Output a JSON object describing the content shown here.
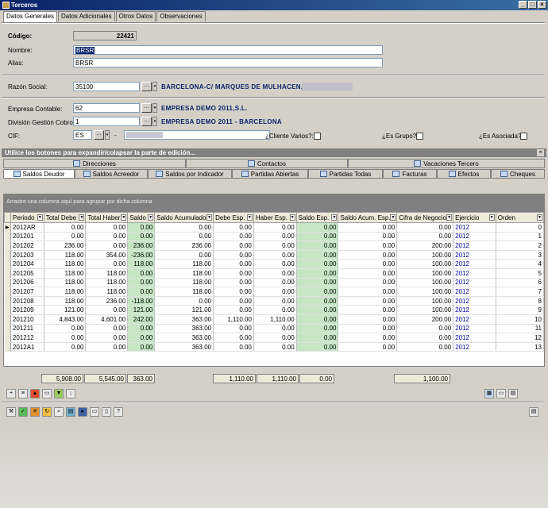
{
  "window": {
    "title": "Terceros",
    "min": "_",
    "max": "□",
    "close": "×"
  },
  "main_tabs": [
    "Datos Generales",
    "Datos Adicionales",
    "Otros Datos",
    "Observaciones"
  ],
  "form": {
    "codigo_label": "Código:",
    "codigo": "22421",
    "nombre_label": "Nombre:",
    "nombre": "BRSR",
    "alias_label": "Alias:",
    "alias": "BRSR",
    "razon_label": "Razón Social:",
    "razon_code": "35100",
    "razon_desc": "BARCELONA-C/ MARQUES DE MULHACEN,",
    "empresa_label": "Empresa Contable:",
    "empresa_code": "62",
    "empresa_desc": "EMPRESA DEMO 2011,S.L.",
    "division_label": "División Gestión Cobros:",
    "division_code": "1",
    "division_desc": "EMPRESA DEMO 2011 - BARCELONA",
    "cif_label": "CIF:",
    "cif_country": "ES",
    "cif_dash": "-",
    "cliente_varios": "¿Cliente Varios?:",
    "es_grupo": "¿Es Grupo?:",
    "es_asociada": "¿Es Asociada?:",
    "ellipsis": "...",
    "dropdown": "▾"
  },
  "group_header": "Utilice los botones para expandir/colapsar la parte de edición...",
  "sub_tabs_row1": [
    "Direcciones",
    "Contactos",
    "Vacaciones Tercero"
  ],
  "sub_tabs_row2": [
    "Saldos Deudor",
    "Saldos Acreedor",
    "Saldos por Indicador",
    "Partidas Abiertas",
    "Partidas Todas",
    "Facturas",
    "Efectos",
    "Cheques"
  ],
  "drag_hint": "Arrastre una columna aquí para agrupar por dicha columna",
  "columns": [
    "Periodo",
    "Total Debe",
    "Total Haber",
    "Saldo",
    "Saldo Acumulado",
    "Debe Esp.",
    "Haber Esp.",
    "Saldo Esp.",
    "Saldo Acum. Esp.",
    "Cifra de Negocio",
    "Ejercicio",
    "Orden"
  ],
  "rows": [
    [
      "2012AR",
      "0.00",
      "0.00",
      "0.00",
      "0.00",
      "0.00",
      "0.00",
      "0.00",
      "0.00",
      "0.00",
      "2012",
      "0"
    ],
    [
      "201201",
      "0.00",
      "0.00",
      "0.00",
      "0.00",
      "0.00",
      "0.00",
      "0.00",
      "0.00",
      "0.00",
      "2012",
      "1"
    ],
    [
      "201202",
      "236.00",
      "0.00",
      "236.00",
      "236.00",
      "0.00",
      "0.00",
      "0.00",
      "0.00",
      "200.00",
      "2012",
      "2"
    ],
    [
      "201203",
      "118.00",
      "354.00",
      "-236.00",
      "0.00",
      "0.00",
      "0.00",
      "0.00",
      "0.00",
      "100.00",
      "2012",
      "3"
    ],
    [
      "201204",
      "118.00",
      "0.00",
      "118.00",
      "118.00",
      "0.00",
      "0.00",
      "0.00",
      "0.00",
      "100.00",
      "2012",
      "4"
    ],
    [
      "201205",
      "118.00",
      "118.00",
      "0.00",
      "118.00",
      "0.00",
      "0.00",
      "0.00",
      "0.00",
      "100.00",
      "2012",
      "5"
    ],
    [
      "201206",
      "118.00",
      "118.00",
      "0.00",
      "118.00",
      "0.00",
      "0.00",
      "0.00",
      "0.00",
      "100.00",
      "2012",
      "6"
    ],
    [
      "201207",
      "118.00",
      "118.00",
      "0.00",
      "118.00",
      "0.00",
      "0.00",
      "0.00",
      "0.00",
      "100.00",
      "2012",
      "7"
    ],
    [
      "201208",
      "118.00",
      "236.00",
      "-118.00",
      "0.00",
      "0.00",
      "0.00",
      "0.00",
      "0.00",
      "100.00",
      "2012",
      "8"
    ],
    [
      "201209",
      "121.00",
      "0.00",
      "121.00",
      "121.00",
      "0.00",
      "0.00",
      "0.00",
      "0.00",
      "100.00",
      "2012",
      "9"
    ],
    [
      "201210",
      "4,843.00",
      "4,601.00",
      "242.00",
      "363.00",
      "1,110.00",
      "1,110.00",
      "0.00",
      "0.00",
      "200.00",
      "2012",
      "10"
    ],
    [
      "201211",
      "0.00",
      "0.00",
      "0.00",
      "363.00",
      "0.00",
      "0.00",
      "0.00",
      "0.00",
      "0.00",
      "2012",
      "11"
    ],
    [
      "201212",
      "0.00",
      "0.00",
      "0.00",
      "363.00",
      "0.00",
      "0.00",
      "0.00",
      "0.00",
      "0.00",
      "2012",
      "12"
    ],
    [
      "2012A1",
      "0.00",
      "0.00",
      "0.00",
      "363.00",
      "0.00",
      "0.00",
      "0.00",
      "0.00",
      "0.00",
      "2012",
      "13"
    ]
  ],
  "totals": {
    "total_debe": "5,908.00",
    "total_haber": "5,545.00",
    "saldo": "363.00",
    "debe_esp": "1,110.00",
    "haber_esp": "1,110.00",
    "saldo_esp": "0.00",
    "cifra": "1,100.00"
  }
}
